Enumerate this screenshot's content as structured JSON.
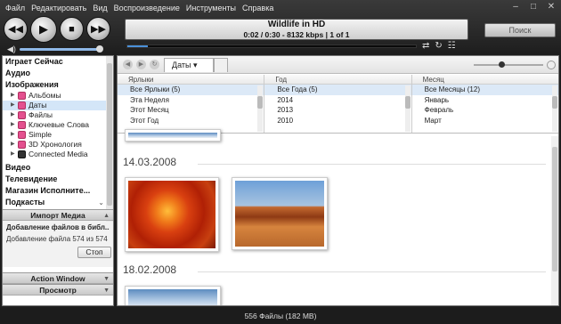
{
  "menu": [
    "Файл",
    "Редактировать",
    "Вид",
    "Воспроизведение",
    "Инструменты",
    "Справка"
  ],
  "window_buttons": [
    "–",
    "□",
    "✕"
  ],
  "now_playing": {
    "title": "Wildlife in HD",
    "info": "0:02 / 0:30 - 8132 kbps | 1 of 1"
  },
  "playback_progress": 0.07,
  "volume_level": 1.0,
  "search_placeholder": "Поиск",
  "sidebar": {
    "sections_top": [
      {
        "label": "Играет Сейчас"
      },
      {
        "label": "Аудио"
      },
      {
        "label": "Изображения"
      }
    ],
    "image_items": [
      {
        "label": "Альбомы",
        "selected": false,
        "icon": "album-icon"
      },
      {
        "label": "Даты",
        "selected": true,
        "icon": "calendar-icon"
      },
      {
        "label": "Файлы",
        "selected": false,
        "icon": "folder-icon"
      },
      {
        "label": "Ключевые Слова",
        "selected": false,
        "icon": "tag-icon"
      },
      {
        "label": "Simple",
        "selected": false,
        "icon": "simple-icon"
      },
      {
        "label": "3D Хронология",
        "selected": false,
        "icon": "timeline-icon"
      },
      {
        "label": "Connected Media",
        "selected": false,
        "icon": "connected-media-icon"
      }
    ],
    "sections_bottom": [
      {
        "label": "Видео"
      },
      {
        "label": "Телевидение"
      },
      {
        "label": "Магазин Исполните..."
      },
      {
        "label": "Подкасты"
      }
    ],
    "import_header": "Импорт Медиа",
    "import_status": "Добавление файлов в библ...",
    "import_progress": "Добавление файла 574 из 574",
    "stop_label": "Стоп",
    "action_window": "Action Window",
    "preview": "Просмотр"
  },
  "toolbar": {
    "tab_label": "Даты"
  },
  "filters": {
    "columns": [
      {
        "header": "Ярлыки",
        "rows": [
          "Все Ярлыки (5)",
          "Эта Неделя",
          "Этот Месяц",
          "Этот Год"
        ]
      },
      {
        "header": "Год",
        "rows": [
          "Все Года (5)",
          "2014",
          "2013",
          "2010"
        ]
      },
      {
        "header": "Месяц",
        "rows": [
          "Все Месяцы (12)",
          "Январь",
          "Февраль",
          "Март"
        ]
      }
    ]
  },
  "gallery": {
    "groups": [
      {
        "date": "14.03.2008"
      },
      {
        "date": "18.02.2008"
      }
    ]
  },
  "status": "556 Файлы (182 MB)",
  "colors": {
    "accent": "#4a90d9",
    "selection": "#d4e6f8"
  }
}
